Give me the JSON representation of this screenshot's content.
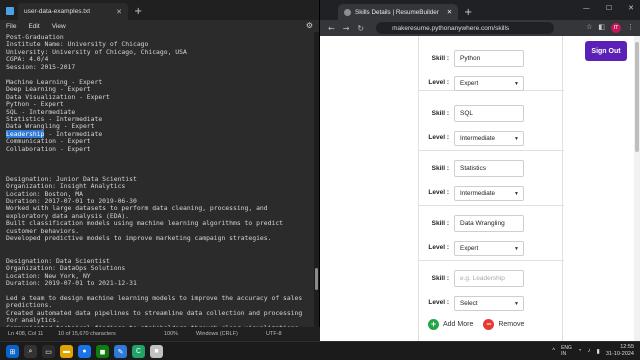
{
  "notepad": {
    "tab_title": "user-data-examples.txt",
    "menu": [
      "File",
      "Edit",
      "View"
    ],
    "lines_before_highlight": "Post-Graduation\nInstitute Name: University of Chicago\nUniversity: University of Chicago, Chicago, USA\nCGPA: 4.0/4\nSession: 2015-2017\n\nMachine Learning - Expert\nDeep Learning - Expert\nData Visualization - Expert\nPython - Expert\nSQL - Intermediate\nStatistics - Intermediate\nData Wrangling - Expert\n",
    "highlighted_word": "Leadership",
    "lines_after_highlight": " - Intermediate\nCommunication - Expert\nCollaboration - Expert\n\n\n\nDesignation: Junior Data Scientist\nOrganization: Insight Analytics\nLocation: Boston, MA\nDuration: 2017-07-01 to 2019-06-30\nWorked with large datasets to perform data cleaning, processing, and exploratory data analysis (EDA).\nBuilt classification models using machine learning algorithms to predict customer behaviors.\nDeveloped predictive models to improve marketing campaign strategies.\n\n\nDesignation: Data Scientist\nOrganization: DataOps Solutions\nLocation: New York, NY\nDuration: 2019-07-01 to 2021-12-31\n\nLed a team to design machine learning models to improve the accuracy of sales predictions.\nCreated automated data pipelines to streamline data collection and processing for analytics.\nCommunicated technical findings to stakeholders through clear visualizations and presentations.",
    "status": {
      "position": "Ln 408, Col 11",
      "chars": "10 of 15,670 characters",
      "zoom": "100%",
      "line_ending": "Windows (CRLF)",
      "encoding": "UTF-8"
    }
  },
  "browser": {
    "tab_title": "Skills Details | ResumeBuilder",
    "url": "makeresume.pythonanywhere.com/skills",
    "avatar_text": "IT",
    "signout_label": "Sign Out",
    "skill_label": "Skill :",
    "level_label": "Level :",
    "skills": [
      {
        "skill": "Python",
        "level": "Expert"
      },
      {
        "skill": "SQL",
        "level": "Intermediate"
      },
      {
        "skill": "Statistics",
        "level": "Intermediate"
      },
      {
        "skill": "Data Wrangling",
        "level": "Expert"
      }
    ],
    "new_skill_placeholder": "e.g. Leadership",
    "new_level": "Select",
    "add_more_label": "Add More",
    "remove_label": "Remove"
  },
  "taskbar": {
    "language": "ENG\nIN",
    "time": "12:55",
    "date": "31-10-2024"
  }
}
